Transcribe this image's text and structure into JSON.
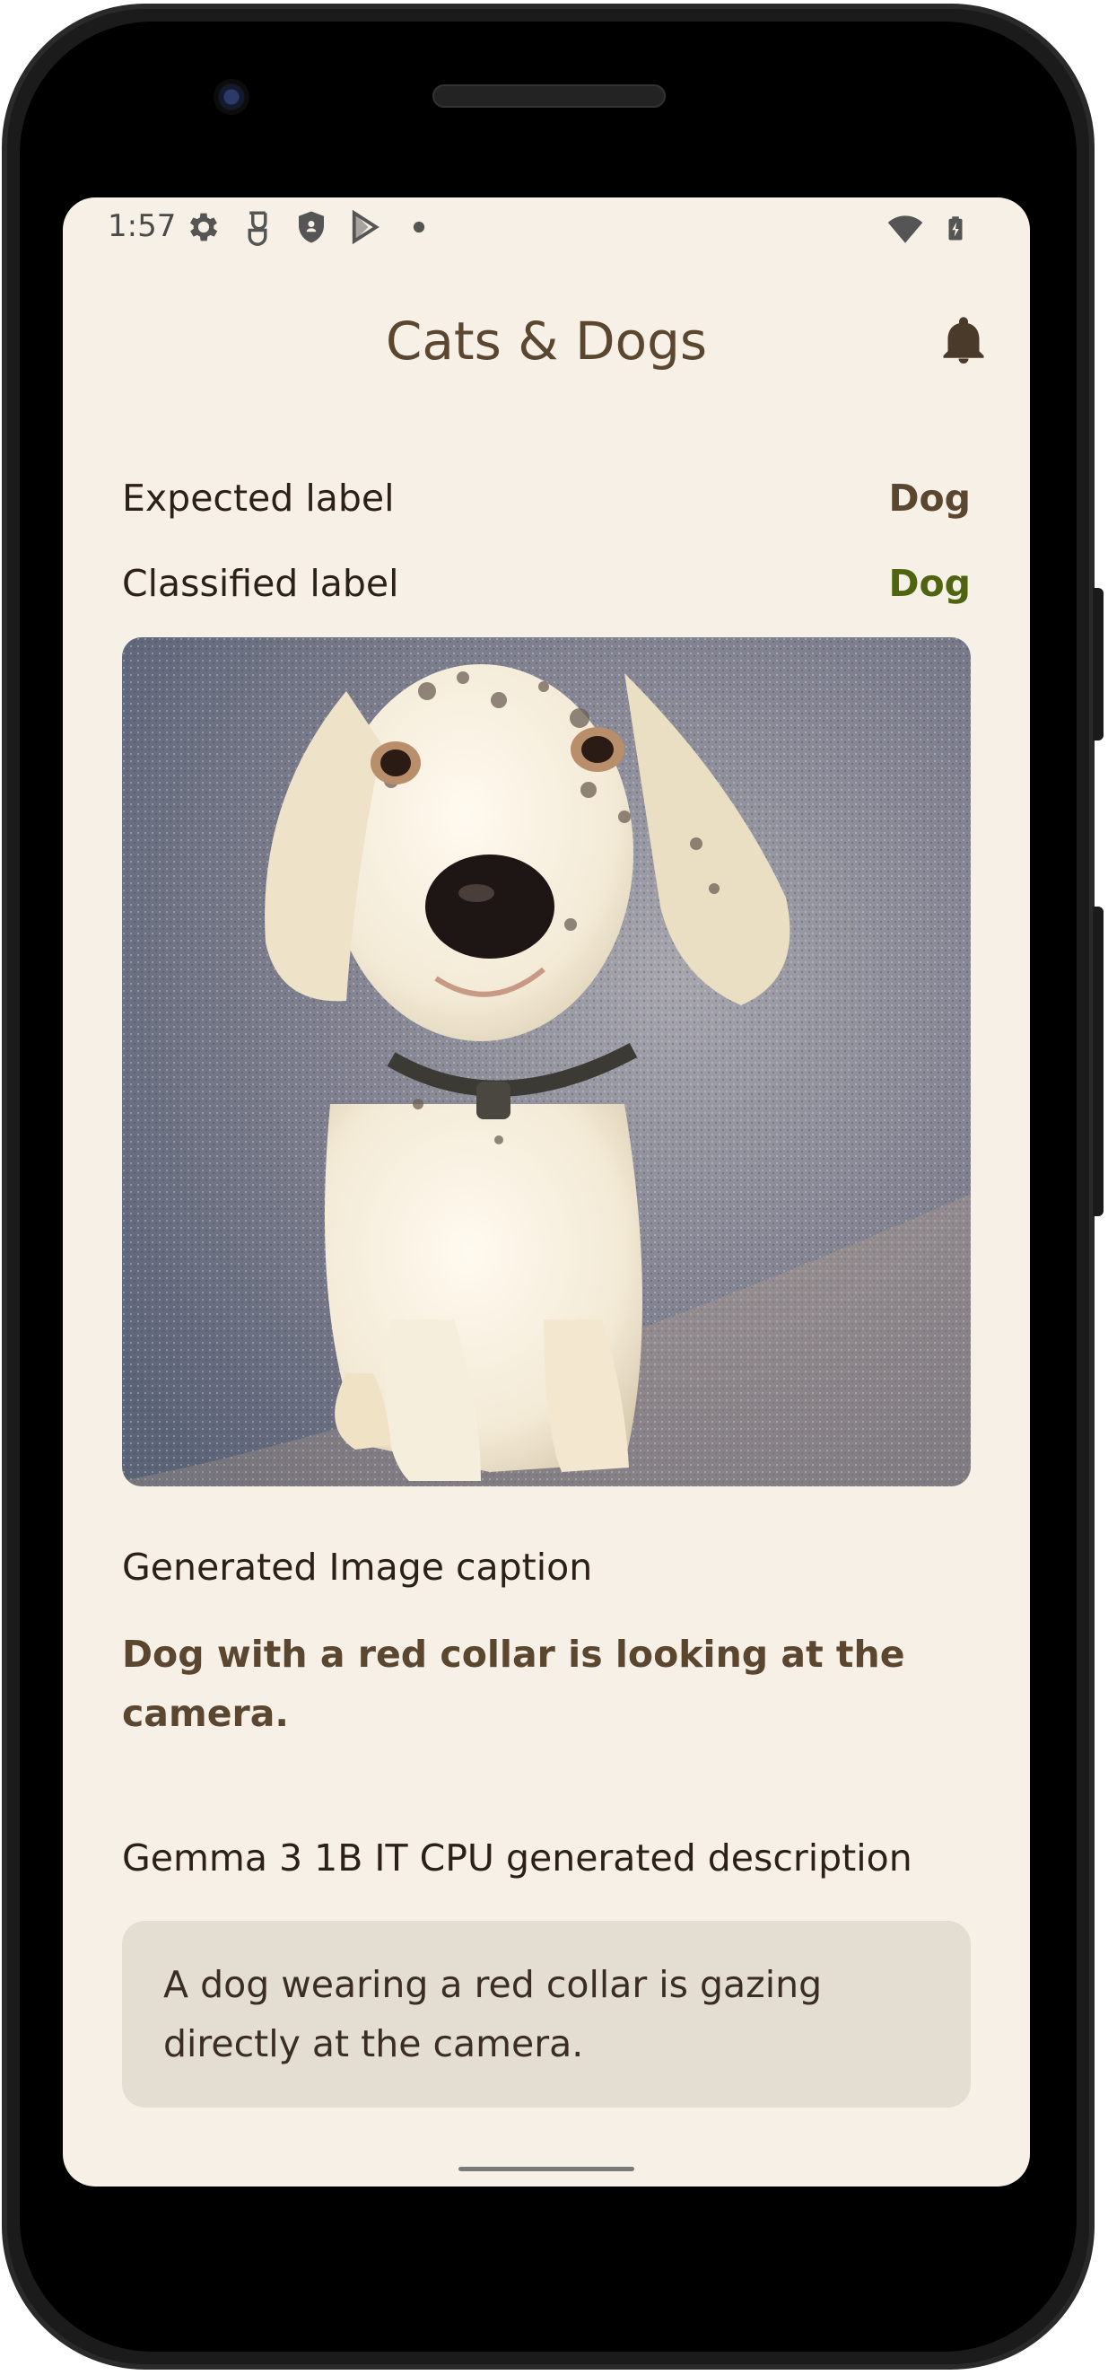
{
  "status_bar": {
    "time": "1:57",
    "left_icons": [
      "gear-icon",
      "vpn-key-icon",
      "shield-icon",
      "play-store-icon",
      "dot-icon"
    ],
    "right_icons": [
      "wifi-icon",
      "battery-charging-icon"
    ]
  },
  "app_bar": {
    "title": "Cats & Dogs",
    "action_icon": "bell-icon"
  },
  "labels": {
    "expected_label": "Expected label",
    "expected_value": "Dog",
    "classified_label": "Classified label",
    "classified_value": "Dog"
  },
  "image": {
    "subject": "dog-photo"
  },
  "caption_section": {
    "heading": "Generated Image caption",
    "text": "Dog with a red collar is looking at the camera."
  },
  "description_section": {
    "heading": "Gemma 3 1B IT CPU generated description",
    "text": "A dog wearing a red collar is gazing directly at the camera."
  },
  "colors": {
    "background": "#f7f0e6",
    "title": "#5b4630",
    "expected_value": "#5b4630",
    "classified_value": "#4f6410",
    "card": "#e4ddd1"
  }
}
